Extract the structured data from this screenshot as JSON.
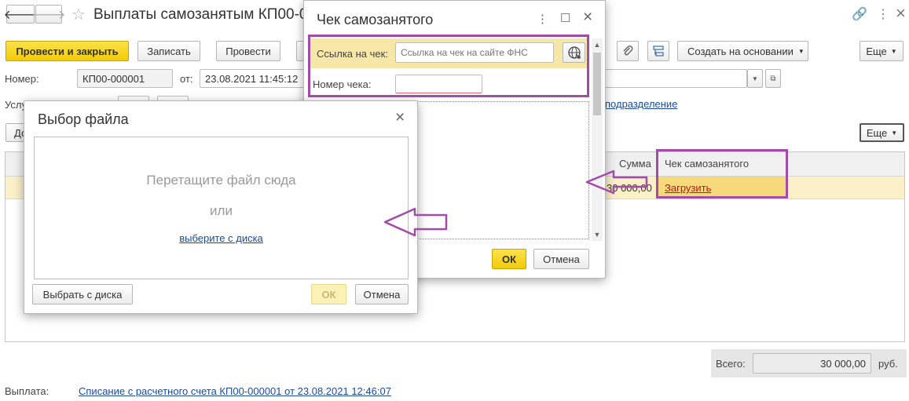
{
  "main": {
    "title": "Выплаты самозанятым КП00-0",
    "nav": {
      "back": "🡐",
      "forward": "🡒",
      "star": "☆"
    },
    "window_icons": {
      "link": "🔗",
      "menu": "⋮",
      "close": "×"
    },
    "toolbar": {
      "post_close": "Провести и закрыть",
      "write": "Записать",
      "post": "Провести",
      "create_basis": "Создать на основании",
      "more": "Еще"
    },
    "number_label": "Номер:",
    "number_value": "КП00-000001",
    "date_label": "от:",
    "date_value": "23.08.2021 11:45:12",
    "services_label": "Услу",
    "subdivision_link": "подразделение",
    "table_more": "Еще",
    "add_button_fragment": "До",
    "table": {
      "col_sum": "Сумма",
      "col_check": "Чек самозанятого",
      "row_sum": "30 000,00",
      "row_check_link": "Загрузить"
    },
    "total_label": "Всего:",
    "total_value": "30 000,00",
    "total_currency": "руб.",
    "payment_label": "Выплата:",
    "payment_link": "Списание с расчетного счета КП00-000001 от 23.08.2021 12:46:07"
  },
  "check_dialog": {
    "title": "Чек самозанятого",
    "window_icons": {
      "menu": "⋮",
      "maximize": "☐",
      "close": "×"
    },
    "link_label": "Ссылка на чек:",
    "link_placeholder": "Ссылка на чек на сайте ФНС",
    "number_label": "Номер чека:",
    "number_value": "",
    "ok": "ОК",
    "cancel": "Отмена"
  },
  "file_dialog": {
    "title": "Выбор файла",
    "close": "×",
    "drop_text": "Перетащите файл сюда",
    "or_text": "или",
    "choose_link": "выберите с диска",
    "choose_button": "Выбрать с диска",
    "ok": "ОК",
    "cancel": "Отмена"
  },
  "colors": {
    "accent_yellow": "#f2cb08",
    "highlight_row": "#fbf0c8",
    "annotation_purple": "#a24ba8",
    "link_red": "#c0141a",
    "link_blue": "#1c4a9c"
  }
}
